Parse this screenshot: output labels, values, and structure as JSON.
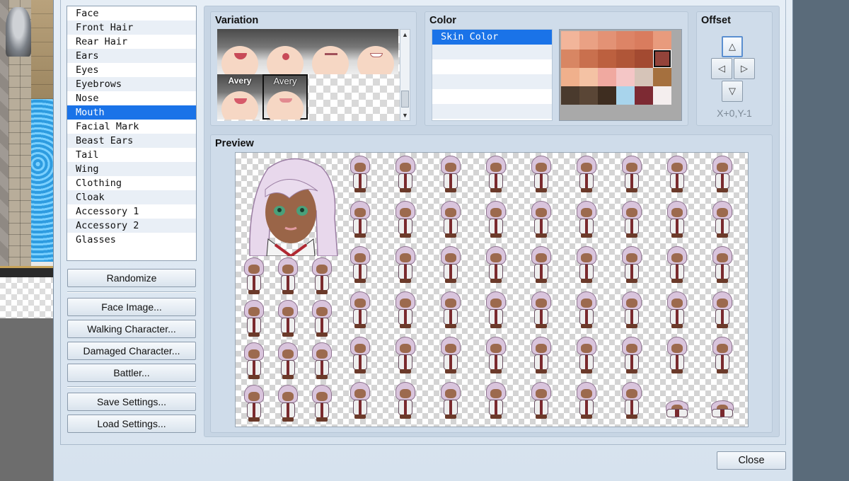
{
  "parts_list": {
    "items": [
      "Face",
      "Front Hair",
      "Rear Hair",
      "Ears",
      "Eyes",
      "Eyebrows",
      "Nose",
      "Mouth",
      "Facial Mark",
      "Beast Ears",
      "Tail",
      "Wing",
      "Clothing",
      "Cloak",
      "Accessory 1",
      "Accessory 2",
      "Glasses"
    ],
    "selected_index": 7,
    "selected": "Mouth"
  },
  "buttons": {
    "randomize": "Randomize",
    "face_image": "Face Image...",
    "walking_character": "Walking Character...",
    "damaged_character": "Damaged Character...",
    "battler": "Battler...",
    "save_settings": "Save Settings...",
    "load_settings": "Load Settings...",
    "close": "Close"
  },
  "variation": {
    "title": "Variation",
    "labels": [
      "",
      "",
      "",
      "",
      "Avery",
      "Avery"
    ],
    "selected_index": 5
  },
  "color": {
    "title": "Color",
    "items": [
      "Skin Color",
      "",
      "",
      "",
      "",
      ""
    ],
    "selected": "Skin Color",
    "palette": [
      "#f2b59a",
      "#eaa184",
      "#e39275",
      "#dd8466",
      "#d97c5e",
      "#e89b7d",
      "#d88663",
      "#c9704e",
      "#bc603f",
      "#b05638",
      "#a34a31",
      "#93433a",
      "#f0b08c",
      "#f4c2a4",
      "#f0a9a0",
      "#f4c6c6",
      "#d6c4b8",
      "#a5703e",
      "#4a3a2d",
      "#5a4636",
      "#3e2d20",
      "#a8d4ec",
      "#7d2a33",
      "#f4eeee"
    ],
    "selected_swatch": 11
  },
  "offset": {
    "title": "Offset",
    "readout": "X+0,Y-1",
    "up_icon": "triangle-up",
    "left_icon": "triangle-left",
    "right_icon": "triangle-right",
    "down_icon": "triangle-down"
  },
  "preview": {
    "title": "Preview"
  }
}
